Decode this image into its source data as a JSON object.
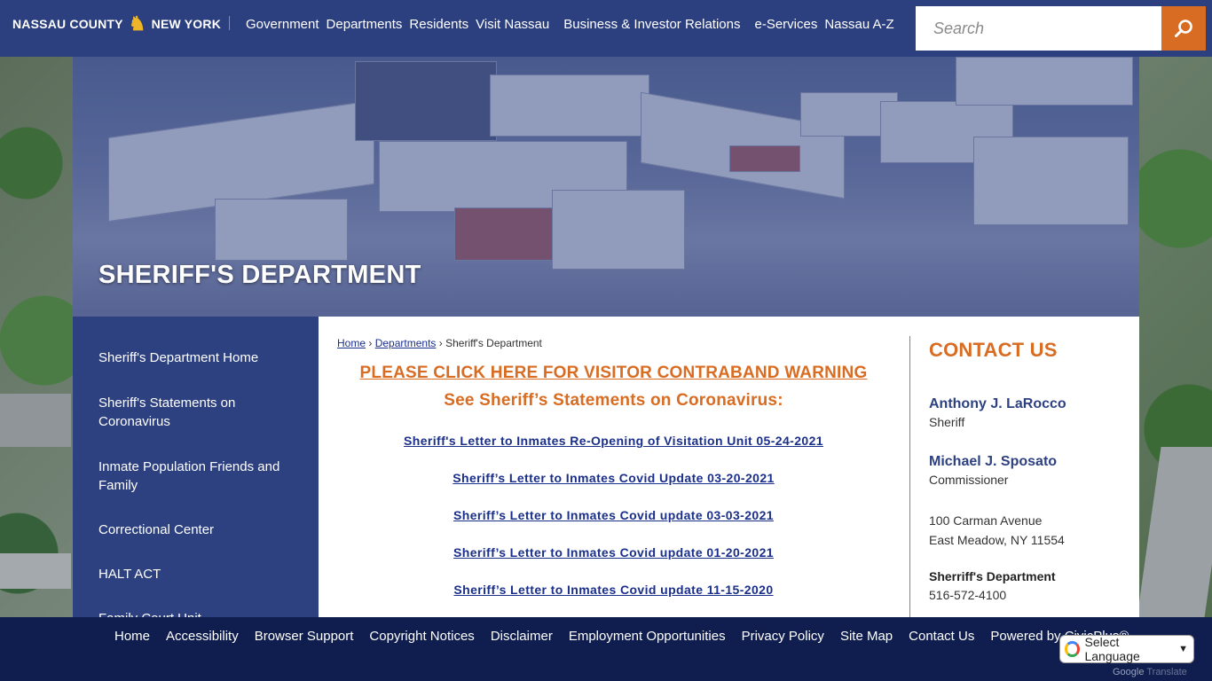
{
  "header": {
    "logo_left": "NASSAU COUNTY",
    "logo_right": "NEW YORK",
    "nav": [
      "Government",
      "Departments",
      "Residents",
      "Visit Nassau",
      "Business & Investor Relations",
      "e-Services",
      "Nassau A-Z"
    ],
    "search_placeholder": "Search"
  },
  "banner": {
    "title": "SHERIFF'S DEPARTMENT"
  },
  "sidebar": {
    "items": [
      "Sheriff's Department Home",
      "Sheriff's Statements on Coronavirus",
      "Inmate Population Friends and Family",
      "Correctional Center",
      "HALT ACT",
      "Family Court Unit"
    ]
  },
  "breadcrumb": {
    "home": "Home",
    "departments": "Departments",
    "current": "Sheriff's Department",
    "separator": "›"
  },
  "content": {
    "warning": "PLEASE CLICK HERE FOR VISITOR CONTRABAND WARNING",
    "subheading": "See Sheriff’s Statements on Coronavirus:",
    "letters": [
      "Sheriff's Letter to Inmates Re-Opening of Visitation Unit 05-24-2021",
      "Sheriff’s Letter to Inmates Covid Update 03-20-2021",
      "Sheriff’s Letter to Inmates Covid update 03-03-2021",
      "Sheriff’s Letter to Inmates Covid update 01-20-2021",
      "Sheriff’s Letter to Inmates Covid update 11-15-2020"
    ]
  },
  "contact": {
    "heading": "CONTACT US",
    "sheriff_name": "Anthony J. LaRocco",
    "sheriff_role": "Sheriff",
    "commissioner_name": "Michael J. Sposato",
    "commissioner_role": "Commissioner",
    "address_line1": "100 Carman Avenue",
    "address_line2": "East Meadow, NY 11554",
    "dept_label": "Sherriff's Department",
    "phone": "516-572-4100"
  },
  "footer": {
    "links": [
      "Home",
      "Accessibility",
      "Browser Support",
      "Copyright Notices",
      "Disclaimer",
      "Employment Opportunities",
      "Privacy Policy",
      "Site Map",
      "Contact Us",
      "Powered by CivicPlus®"
    ]
  },
  "translate": {
    "label": "Select Language",
    "powered_google": "Google",
    "powered_translate": "Translate"
  },
  "colors": {
    "header": "#2c3f7e",
    "accent": "#d86c22",
    "sidebar": "#2d4181",
    "footer": "#0f1e4e",
    "link": "#1a2f8a"
  },
  "icons": {
    "seal": "nassau-seal-icon",
    "search": "search-icon",
    "google": "google-icon",
    "caret": "chevron-down-icon"
  }
}
